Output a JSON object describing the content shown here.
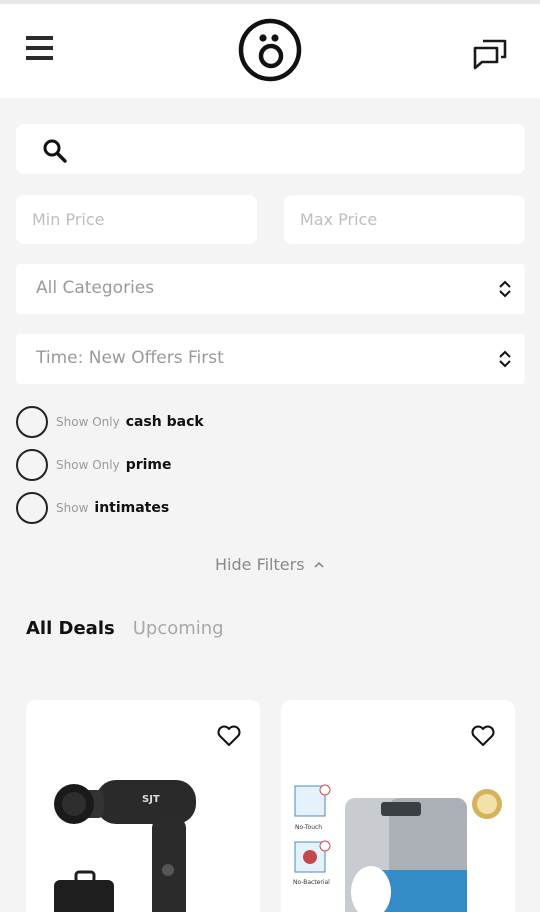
{
  "header": {
    "menu_icon": "hamburger-menu-icon",
    "logo_icon": "surprised-face-logo",
    "chat_icon": "chat-bubbles-icon"
  },
  "filters": {
    "search_icon": "search-icon",
    "search_value": "",
    "min_price_placeholder": "Min Price",
    "max_price_placeholder": "Max Price",
    "category_select": "All Categories",
    "time_select": "Time: New Offers First",
    "checkboxes": [
      {
        "prefix": "Show Only",
        "label": "cash back",
        "checked": false
      },
      {
        "prefix": "Show Only",
        "label": "prime",
        "checked": false
      },
      {
        "prefix": "Show",
        "label": "intimates",
        "checked": false
      }
    ],
    "hide_filters_label": "Hide Filters"
  },
  "tabs": [
    {
      "label": "All Deals",
      "active": true
    },
    {
      "label": "Upcoming",
      "active": false
    }
  ],
  "products": [
    {
      "image": "massage-gun-with-carrying-case",
      "brand_mark": "SJT",
      "favorited": false
    },
    {
      "image": "touchless-foam-soap-dispenser",
      "badge_1": "No-Touch",
      "badge_2": "No-Bacterial",
      "favorited": false
    }
  ],
  "colors": {
    "background": "#f4f4f4",
    "surface": "#ffffff",
    "text_primary": "#111111",
    "text_muted": "#9a9a9a"
  }
}
